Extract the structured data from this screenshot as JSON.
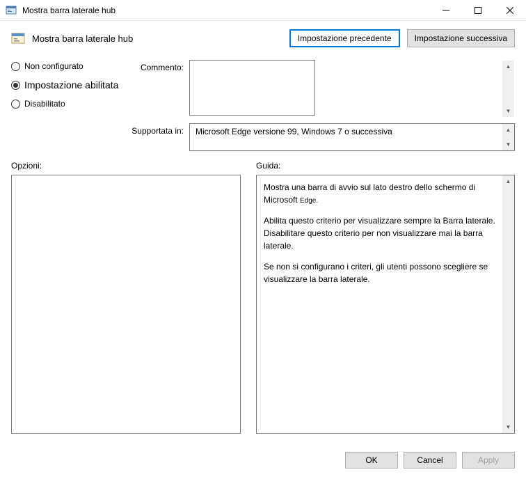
{
  "window": {
    "title": "Mostra barra laterale hub"
  },
  "header": {
    "title": "Mostra barra laterale hub",
    "prev_btn": "Impostazione precedente",
    "next_btn": "Impostazione successiva"
  },
  "radios": {
    "not_configured": "Non configurato",
    "enabled": "Impostazione abilitata",
    "disabled": "Disabilitato"
  },
  "labels": {
    "comment": "Commento:",
    "supported": "Supportata in:",
    "options": "Opzioni:",
    "guide": "Guida:"
  },
  "supported_text": "Microsoft Edge versione 99, Windows 7 o successiva",
  "guide": {
    "p1a": "Mostra una barra di avvio sul lato destro dello schermo di Microsoft ",
    "p1b": "Edge.",
    "p2": "Abilita questo criterio per visualizzare sempre la Barra laterale. Disabilitare questo criterio per non visualizzare mai la barra laterale.",
    "p3": "Se non si configurano i criteri, gli utenti possono scegliere se visualizzare la barra laterale."
  },
  "footer": {
    "ok": "OK",
    "cancel": "Cancel",
    "apply": "Apply"
  }
}
